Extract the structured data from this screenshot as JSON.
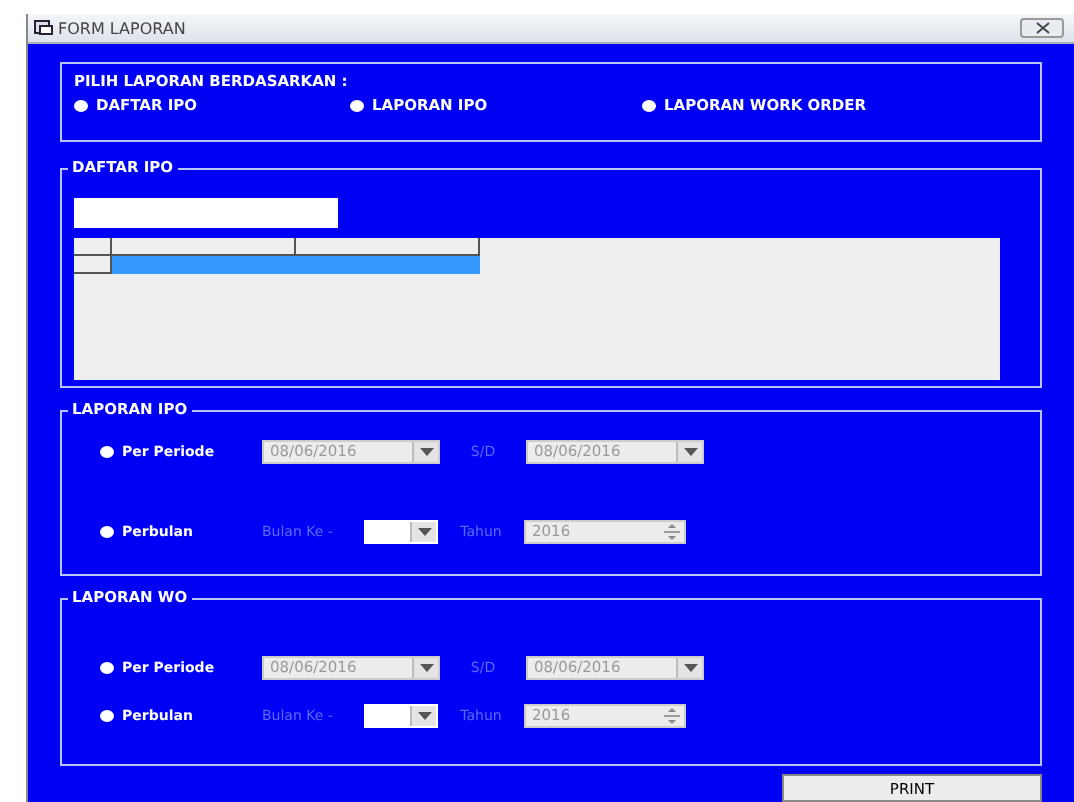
{
  "window": {
    "title": "FORM LAPORAN"
  },
  "report_choice": {
    "title": "PILIH LAPORAN BERDASARKAN :",
    "options": [
      {
        "label": "DAFTAR IPO",
        "selected": false
      },
      {
        "label": "LAPORAN IPO",
        "selected": false
      },
      {
        "label": "LAPORAN WORK ORDER",
        "selected": false
      }
    ]
  },
  "daftar_ipo": {
    "title": "DAFTAR IPO",
    "grid": {
      "rows": [
        {
          "selected": true
        }
      ]
    }
  },
  "sections": [
    {
      "title": "LAPORAN IPO",
      "rows": [
        {
          "kind": "period",
          "label": "Per Periode",
          "selected": false,
          "from": {
            "value": "08/06/2016",
            "disabled": true
          },
          "separator": "S/D",
          "to": {
            "value": "08/06/2016",
            "disabled": true
          }
        },
        {
          "kind": "month",
          "label": "Perbulan",
          "selected": false,
          "month_label": "Bulan Ke -",
          "month": {
            "disabled": false
          },
          "year_label": "Tahun",
          "year": {
            "value": "2016",
            "disabled": true
          }
        }
      ]
    },
    {
      "title": "LAPORAN WO",
      "rows": [
        {
          "kind": "period",
          "label": "Per Periode",
          "selected": false,
          "from": {
            "value": "08/06/2016",
            "disabled": true
          },
          "separator": "S/D",
          "to": {
            "value": "08/06/2016",
            "disabled": true
          }
        },
        {
          "kind": "month",
          "label": "Perbulan",
          "selected": false,
          "month_label": "Bulan Ke -",
          "month": {
            "disabled": false
          },
          "year_label": "Tahun",
          "year": {
            "value": "2016",
            "disabled": true
          }
        }
      ]
    }
  ],
  "print_button": {
    "label": "PRINT"
  }
}
